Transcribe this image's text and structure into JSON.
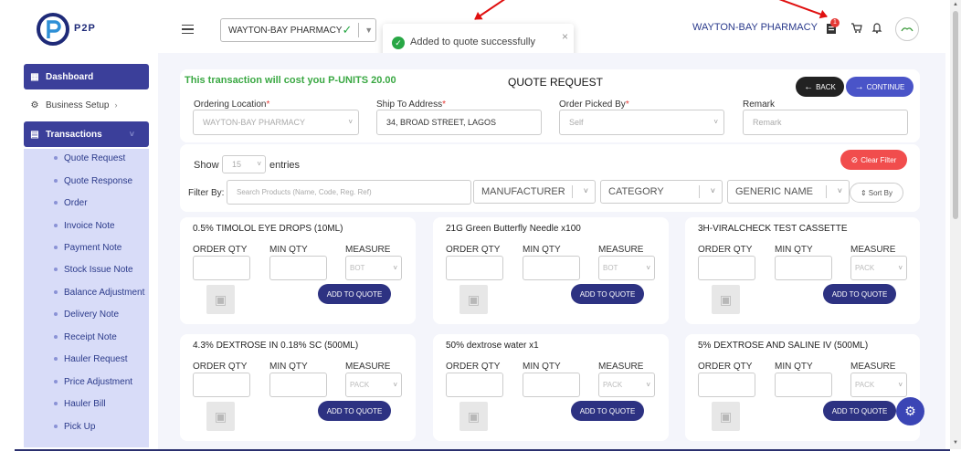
{
  "header": {
    "logo_text": "P2P",
    "store_select": "WAYTON-BAY PHARMACY",
    "org_name": "WAYTON-BAY PHARMACY",
    "notification_count": "1",
    "icons": [
      "menu-icon",
      "check-icon",
      "chevron-down-icon",
      "quote-doc-icon",
      "cart-icon",
      "bell-icon"
    ]
  },
  "toast": {
    "message": "Added to quote successfully",
    "close": "×",
    "progress": 0.51,
    "color": "#28a745"
  },
  "sidebar": {
    "items": [
      {
        "label": "Dashboard",
        "icon": "grid-icon",
        "active": true
      },
      {
        "label": "Business Setup",
        "icon": "gear-icon",
        "active": false
      },
      {
        "label": "Transactions",
        "icon": "document-icon",
        "active": true
      }
    ],
    "submenu": [
      "Quote Request",
      "Quote Response",
      "Order",
      "Invoice Note",
      "Payment Note",
      "Stock Issue Note",
      "Balance Adjustment",
      "Delivery Note",
      "Receipt Note",
      "Hauler Request",
      "Price Adjustment",
      "Hauler Bill",
      "Pick Up"
    ]
  },
  "quote": {
    "cost_text": "This transaction will cost you P-UNITS 20.00",
    "title": "QUOTE REQUEST",
    "back_label": "BACK",
    "continue_label": "CONTINUE",
    "fields": {
      "ordering_location_label": "Ordering Location",
      "ordering_location_value": "WAYTON-BAY PHARMACY",
      "ship_to_label": "Ship To Address",
      "ship_to_value": "34, BROAD STREET, LAGOS",
      "picked_by_label": "Order Picked By",
      "picked_by_value": "Self",
      "remark_label": "Remark",
      "remark_placeholder": "Remark"
    }
  },
  "filters": {
    "show_label": "Show",
    "entries_value": "15",
    "entries_label": "entries",
    "clear_label": "Clear Filter",
    "filter_by_label": "Filter By:",
    "search_placeholder": "Search Products (Name, Code, Reg. Ref)",
    "manufacturer": "MANUFACTURER",
    "category": "CATEGORY",
    "generic_name": "GENERIC NAME",
    "sort_label": "Sort By"
  },
  "product_labels": {
    "order_qty": "ORDER QTY",
    "min_qty": "MIN QTY",
    "measure": "MEASURE",
    "add_label": "ADD TO QUOTE"
  },
  "products": [
    {
      "name": "0.5% TIMOLOL EYE DROPS (10ML)",
      "measure": "BOT"
    },
    {
      "name": "21G Green Butterfly Needle x100",
      "measure": "BOT"
    },
    {
      "name": "3H-VIRALCHECK TEST CASSETTE",
      "measure": "PACK"
    },
    {
      "name": "4.3% DEXTROSE IN 0.18% SC (500ML)",
      "measure": "PACK"
    },
    {
      "name": "50% dextrose water x1",
      "measure": "PACK"
    },
    {
      "name": "5% DEXTROSE AND SALINE IV (500ML)",
      "measure": "PACK"
    }
  ],
  "colors": {
    "primary": "#3b3f9a",
    "accent": "#4a54c8",
    "danger": "#f14d4d",
    "success": "#3aa843",
    "submenu_bg": "#d8dcf8"
  }
}
